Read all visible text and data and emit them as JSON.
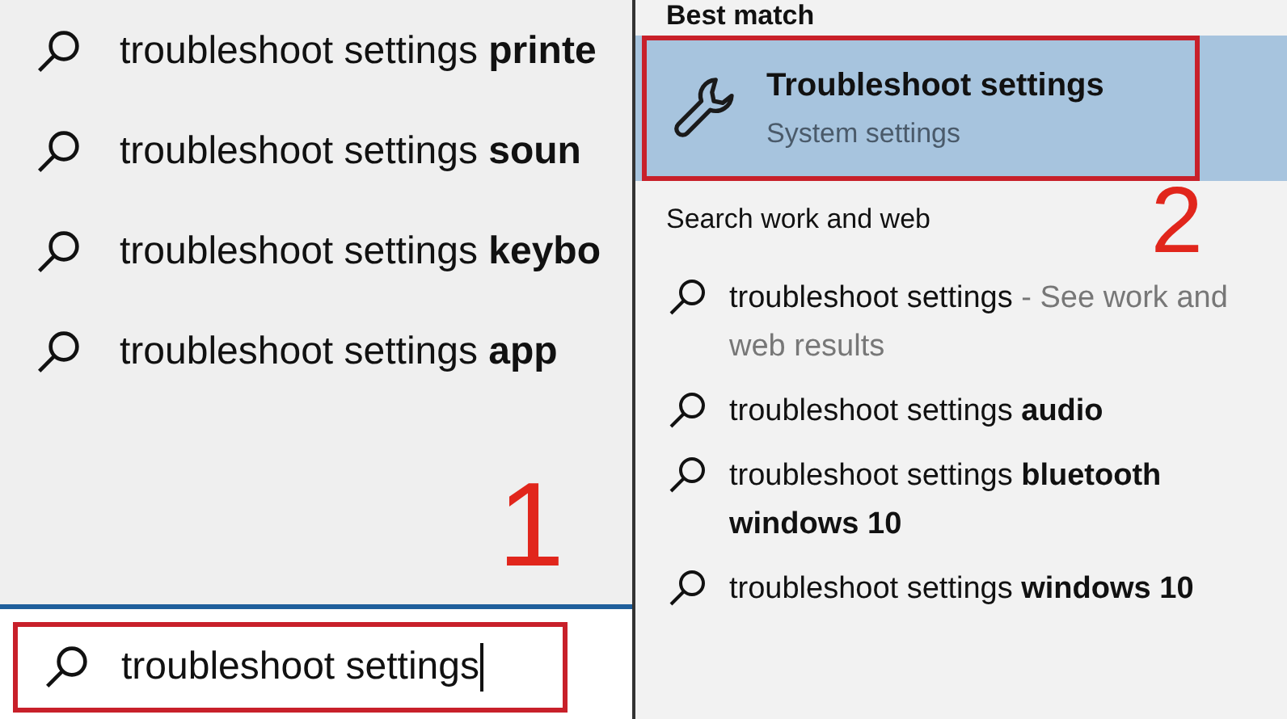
{
  "left_panel": {
    "suggestions": [
      {
        "text": "troubleshoot settings **printe**"
      },
      {
        "text": "troubleshoot settings **soun**"
      },
      {
        "text": "troubleshoot settings **keybo**"
      },
      {
        "text": "troubleshoot settings **app**"
      }
    ],
    "step_label": "1",
    "search": {
      "value": "troubleshoot settings",
      "outlined": true
    }
  },
  "right_panel": {
    "best_match_heading": "Best match",
    "best_match": {
      "title": "Troubleshoot settings",
      "subtitle": "System settings",
      "selected": true,
      "outlined": true
    },
    "step_label": "2",
    "web_heading": "Search work and web",
    "web_results": [
      {
        "text": "troubleshoot settings",
        "note": " - See work and web results"
      },
      {
        "text": "troubleshoot settings **audio**"
      },
      {
        "text": "troubleshoot settings **bluetooth windows 10**"
      },
      {
        "text": "troubleshoot settings **windows 10**"
      }
    ]
  }
}
